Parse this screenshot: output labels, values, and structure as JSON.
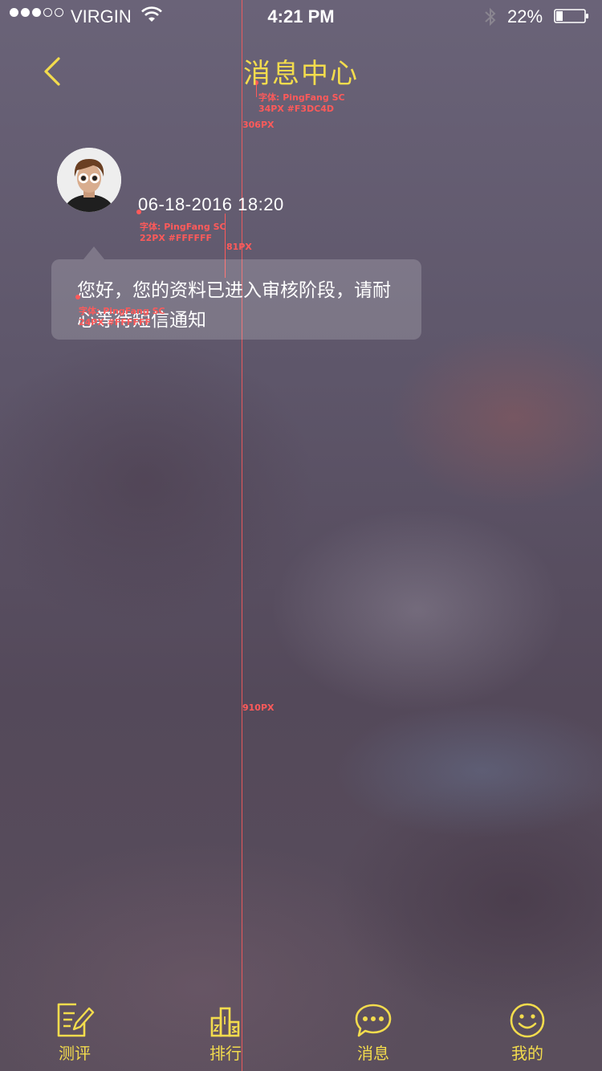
{
  "status_bar": {
    "carrier": "VIRGIN",
    "time": "4:21 PM",
    "battery": "22%"
  },
  "nav": {
    "title": "消息中心"
  },
  "message": {
    "time": "06-18-2016 18:20",
    "text": "您好，您的资料已进入审核阶段，请耐心等待短信通知"
  },
  "annotations": {
    "title_font": "字体: PingFang SC",
    "title_spec": "34PX #F3DC4D",
    "title_gap": "306PX",
    "time_font": "字体: PingFang SC",
    "time_spec": "22PX #FFFFFF",
    "time_gap": "81PX",
    "text_font": "字体: PingFang SC",
    "text_spec": "24PX #FFFFFF",
    "height": "910PX"
  },
  "tabs": [
    {
      "label": "测评",
      "icon": "edit-icon"
    },
    {
      "label": "排行",
      "icon": "ranking-icon"
    },
    {
      "label": "消息",
      "icon": "chat-icon"
    },
    {
      "label": "我的",
      "icon": "smiley-icon"
    }
  ],
  "colors": {
    "accent": "#F3DC4D",
    "annotation": "#FF5A5A"
  }
}
